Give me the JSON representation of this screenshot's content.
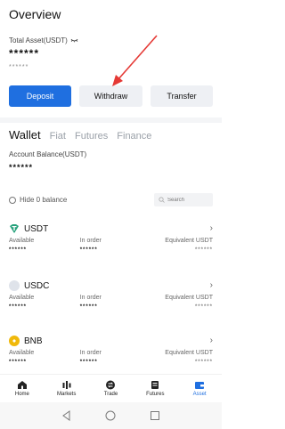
{
  "header": {
    "title": "Overview"
  },
  "total": {
    "label": "Total Asset(USDT)",
    "value": "******",
    "sub": "******"
  },
  "actions": {
    "deposit": "Deposit",
    "withdraw": "Withdraw",
    "transfer": "Transfer"
  },
  "tabs": [
    {
      "label": "Wallet",
      "active": true
    },
    {
      "label": "Fiat"
    },
    {
      "label": "Futures"
    },
    {
      "label": "Finance"
    }
  ],
  "account": {
    "label": "Account Balance(USDT)",
    "value": "******"
  },
  "filter": {
    "hide_label": "Hide 0 balance",
    "search_placeholder": "Search"
  },
  "asset_columns": {
    "available": "Available",
    "in_order": "In order",
    "equivalent": "Equivalent USDT"
  },
  "assets": [
    {
      "name": "USDT",
      "available": "******",
      "in_order": "******",
      "equivalent": "******",
      "color": "#26a17b"
    },
    {
      "name": "USDC",
      "available": "******",
      "in_order": "******",
      "equivalent": "******",
      "color": "#dfe3ea"
    },
    {
      "name": "BNB",
      "available": "******",
      "in_order": "******",
      "equivalent": "******",
      "color": "#f0b90b"
    }
  ],
  "nav": [
    {
      "label": "Home",
      "icon": "home-icon"
    },
    {
      "label": "Markets",
      "icon": "markets-icon"
    },
    {
      "label": "Trade",
      "icon": "trade-icon"
    },
    {
      "label": "Futures",
      "icon": "futures-icon"
    },
    {
      "label": "Asset",
      "icon": "asset-icon",
      "active": true
    }
  ],
  "colors": {
    "accent": "#1f6fe0",
    "annotation": "#e53935"
  }
}
